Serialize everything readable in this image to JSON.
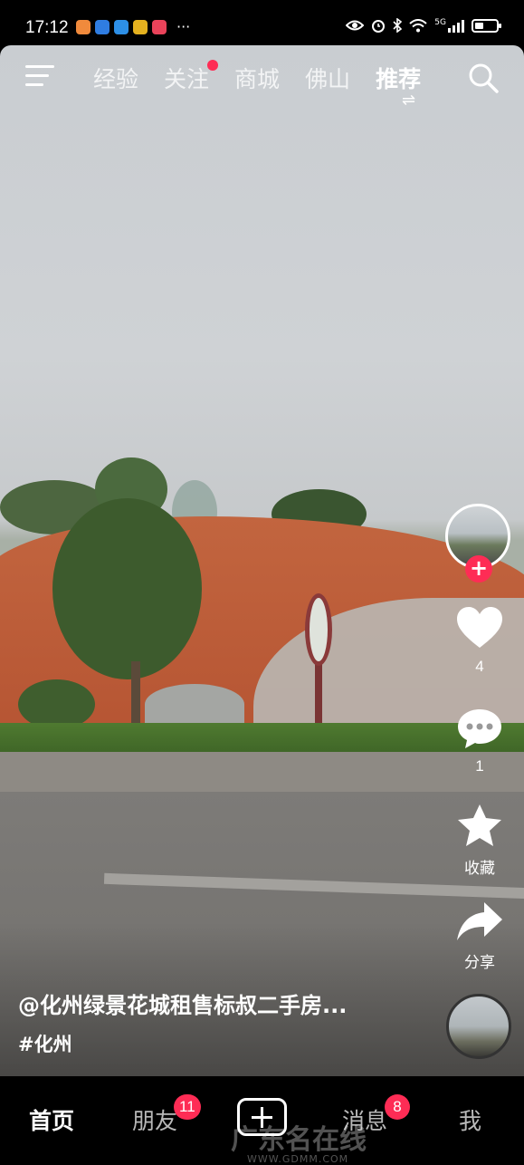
{
  "status_bar": {
    "time": "17:12",
    "more": "···",
    "signal_label": "5G",
    "battery_level": 0.4,
    "app_colors": [
      "#f08a3c",
      "#2f7de1",
      "#2d8fe6",
      "#e4b11f",
      "#e9435a"
    ]
  },
  "top_nav": {
    "tabs": [
      {
        "label": "经验",
        "active": false,
        "has_dot": false
      },
      {
        "label": "关注",
        "active": false,
        "has_dot": true
      },
      {
        "label": "商城",
        "active": false,
        "has_dot": false
      },
      {
        "label": "佛山",
        "active": false,
        "has_dot": false
      },
      {
        "label": "推荐",
        "active": true,
        "has_dot": false
      }
    ],
    "menu_icon": "menu-icon",
    "search_icon": "search-icon",
    "swap_glyph": "⇌"
  },
  "actions": {
    "follow_plus": "+",
    "like_count": "4",
    "comment_count": "1",
    "favorite_label": "收藏",
    "share_label": "分享"
  },
  "caption": {
    "author": "@化州绿景花城租售标叔二手房...",
    "hashtag": "#化州"
  },
  "bottom_nav": {
    "home": "首页",
    "friends": "朋友",
    "friends_badge": "11",
    "messages": "消息",
    "messages_badge": "8",
    "me": "我"
  },
  "watermark": {
    "text": "广东名在线",
    "url": "WWW.GDMM.COM"
  },
  "colors": {
    "accent": "#fe2c55",
    "background": "#000000"
  }
}
